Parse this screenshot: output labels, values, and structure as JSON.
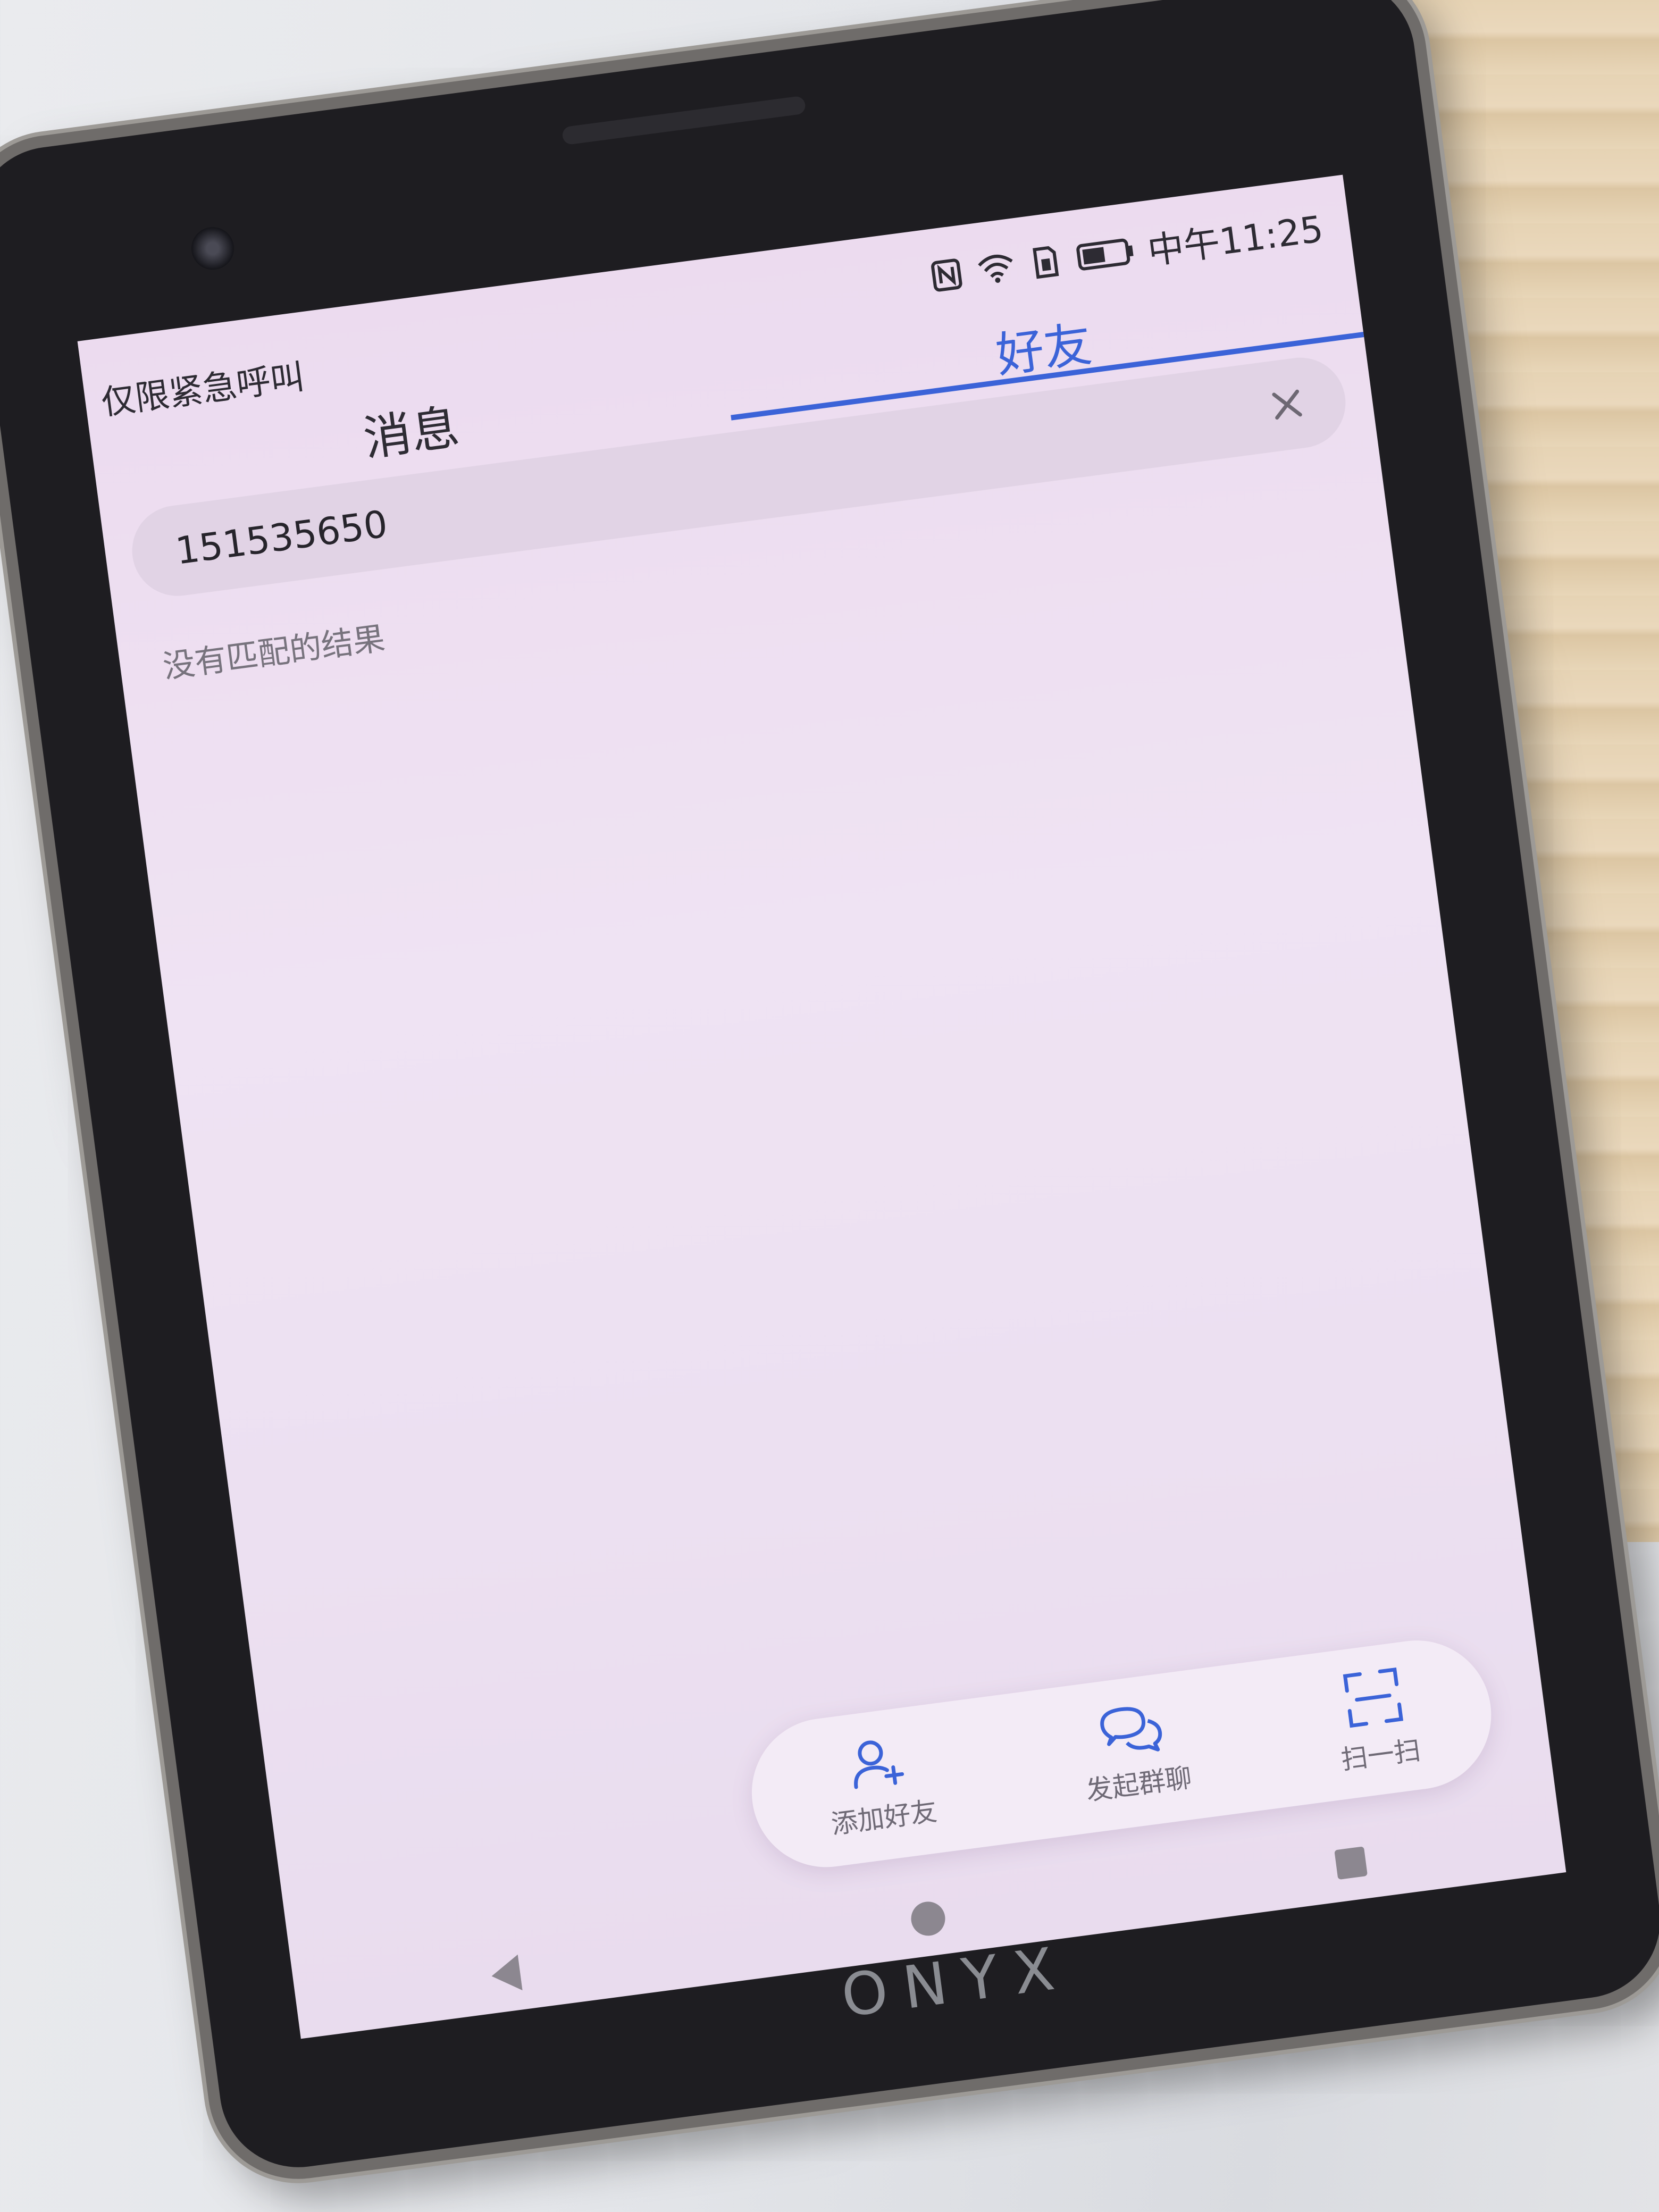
{
  "status_bar": {
    "emergency_text": "仅限紧急呼叫",
    "time": "中午11:25",
    "icons": [
      "nfc-icon",
      "wifi-icon",
      "sim-icon",
      "battery-icon"
    ]
  },
  "tabs": [
    {
      "label": "消息",
      "active": false
    },
    {
      "label": "好友",
      "active": true
    }
  ],
  "search": {
    "value": "151535650",
    "placeholder": ""
  },
  "result_text": "没有匹配的结果",
  "bottom_actions": [
    {
      "label": "添加好友",
      "icon": "add-user-icon"
    },
    {
      "label": "发起群聊",
      "icon": "chat-bubbles-icon"
    },
    {
      "label": "扫一扫",
      "icon": "scan-icon"
    }
  ],
  "brand": "ONYX",
  "colors": {
    "accent": "#3b63d8",
    "screen_bg": "#ecdbef",
    "text_primary": "#2e2c34",
    "text_secondary": "#77737d"
  }
}
